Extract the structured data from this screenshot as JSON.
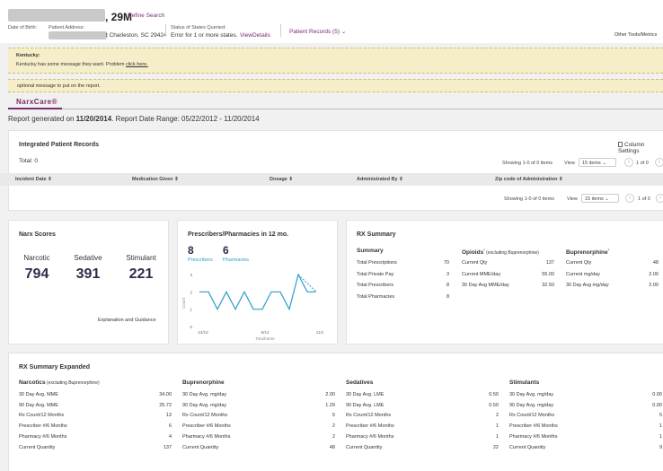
{
  "header": {
    "age_sex": ", 29M",
    "refine_search": "Refine Search",
    "dob_label": "Date of Birth:",
    "address_label": "Patient Address:",
    "address_value": "t Charleston, SC 29424",
    "status_label": "Status of States Queried:",
    "status_value": "Error for 1 or more states.",
    "view_details": "ViewDetails",
    "patient_records": "Patient Records (5)",
    "other_tools": "Other Tools/Metrics"
  },
  "banners": {
    "state_title": "Kentucky:",
    "state_message": "Kentucky has some message they want. Problem ",
    "state_link": "click here.",
    "optional_message": "optional message to put on the report."
  },
  "narxcare": {
    "tab_label": "NarxCare®",
    "report_prefix": "Report generated on ",
    "report_date": "11/20/2014",
    "report_range": ". Report Date Range: 05/22/2012 - 11/20/2014"
  },
  "integrated": {
    "title": "Integrated Patient Records",
    "column_settings": "Column Settings",
    "total": "Total: 0",
    "showing": "Showing 1-0 of 0 items",
    "view": "View",
    "per_page": "15 items",
    "page": "1 of 0",
    "columns": [
      "Incident Date",
      "Medication Given",
      "Dosage",
      "Administrated By",
      "Zip code of Administration"
    ]
  },
  "narx_scores": {
    "title": "Narx Scores",
    "scores": [
      {
        "label": "Narcotic",
        "value": "794"
      },
      {
        "label": "Sedative",
        "value": "391"
      },
      {
        "label": "Stimulant",
        "value": "221"
      }
    ],
    "link": "Explanation and Guidance"
  },
  "prescribers": {
    "title": "Prescribers/Pharmacies in 12 mo.",
    "prescribers_count": "8",
    "prescribers_label": "Prescribers",
    "pharmacies_count": "6",
    "pharmacies_label": "Pharmacies",
    "chart_data": {
      "type": "line",
      "ylabel": "Count",
      "xlabel": "Timeframe",
      "yticks": [
        "3",
        "2",
        "1",
        "0"
      ],
      "xticks": [
        "12/13",
        "5/14",
        "11/1"
      ],
      "ylim": [
        0,
        3
      ],
      "series": [
        {
          "values": [
            2,
            2,
            1,
            2,
            1,
            2,
            1,
            1,
            2,
            2,
            1,
            3,
            2,
            2
          ],
          "color": "#2a9fc7",
          "style": "solid"
        },
        {
          "values": [
            3,
            2
          ],
          "color": "#2a9fc7",
          "style": "dashed",
          "offset": 11
        }
      ],
      "colors": {
        "line": "#2a9fc7"
      }
    }
  },
  "rx_summary": {
    "title": "RX Summary",
    "summary": {
      "heading": "Summary",
      "rows": [
        {
          "label": "Total Prescriptions",
          "value": "70"
        },
        {
          "label": "Total Private Pay",
          "value": "3"
        },
        {
          "label": "Total Prescribers",
          "value": "8"
        },
        {
          "label": "Total Pharmacies",
          "value": "8"
        }
      ]
    },
    "opioids": {
      "heading": "Opioids",
      "sup": "*",
      "note": " (excluding Buprenorphine)",
      "rows": [
        {
          "label": "Current Qty",
          "value": "137"
        },
        {
          "label": "Current MME/day",
          "value": "55.00"
        },
        {
          "label": "30 Day Avg MME/day",
          "value": "32.50"
        }
      ]
    },
    "bup": {
      "heading": "Buprenorphine",
      "sup": "*",
      "rows": [
        {
          "label": "Current Qty",
          "value": "48"
        },
        {
          "label": "Current mg/day",
          "value": "2.00"
        },
        {
          "label": "30 Day Avg mg/day",
          "value": "2.00"
        }
      ]
    }
  },
  "rx_expanded": {
    "title": "RX Summary Expanded",
    "groups": [
      {
        "heading": "Narcotics",
        "note": " (excluding Buprenorphine)",
        "rows": [
          {
            "label": "30 Day Avg. MME",
            "value": "34.00"
          },
          {
            "label": "90 Day Avg. MME",
            "value": "25.72"
          },
          {
            "label": "Rx Count/12 Months",
            "value": "13"
          },
          {
            "label": "Prescriber #/6 Months",
            "value": "6"
          },
          {
            "label": "Pharmacy #/6 Months",
            "value": "4"
          },
          {
            "label": "Current Quantity",
            "value": "137"
          }
        ]
      },
      {
        "heading": "Buprenorphine",
        "note": "",
        "rows": [
          {
            "label": "30 Day Avg. mg/day",
            "value": "2.00"
          },
          {
            "label": "90 Day Avg. mg/day",
            "value": "1.29"
          },
          {
            "label": "Rx Count/12 Months",
            "value": "5"
          },
          {
            "label": "Prescriber #/6 Months",
            "value": "2"
          },
          {
            "label": "Pharmacy #/6 Months",
            "value": "2"
          },
          {
            "label": "Current Quantity",
            "value": "48"
          }
        ]
      },
      {
        "heading": "Sedatives",
        "note": "",
        "rows": [
          {
            "label": "30 Day Avg. LME",
            "value": "0.50"
          },
          {
            "label": "90 Day Avg. LME",
            "value": "0.50"
          },
          {
            "label": "Rx Count/12 Months",
            "value": "2"
          },
          {
            "label": "Prescriber #/6 Months",
            "value": "1"
          },
          {
            "label": "Pharmacy #/6 Months",
            "value": "1"
          },
          {
            "label": "Current Quantity",
            "value": "22"
          }
        ]
      },
      {
        "heading": "Stimulants",
        "note": "",
        "rows": [
          {
            "label": "30 Day Avg. mg/day",
            "value": "0.00"
          },
          {
            "label": "90 Day Avg. mg/day",
            "value": "0.00"
          },
          {
            "label": "Rx Count/12 Months",
            "value": "5"
          },
          {
            "label": "Prescriber #/6 Months",
            "value": "1"
          },
          {
            "label": "Pharmacy #/6 Months",
            "value": "1"
          },
          {
            "label": "Current Quantity",
            "value": "9"
          }
        ]
      }
    ]
  },
  "colors": {
    "accent": "#7a2b6b",
    "score": "#2d2d4a",
    "chart_line": "#2a9fc7",
    "banner": "#f5eec8"
  }
}
